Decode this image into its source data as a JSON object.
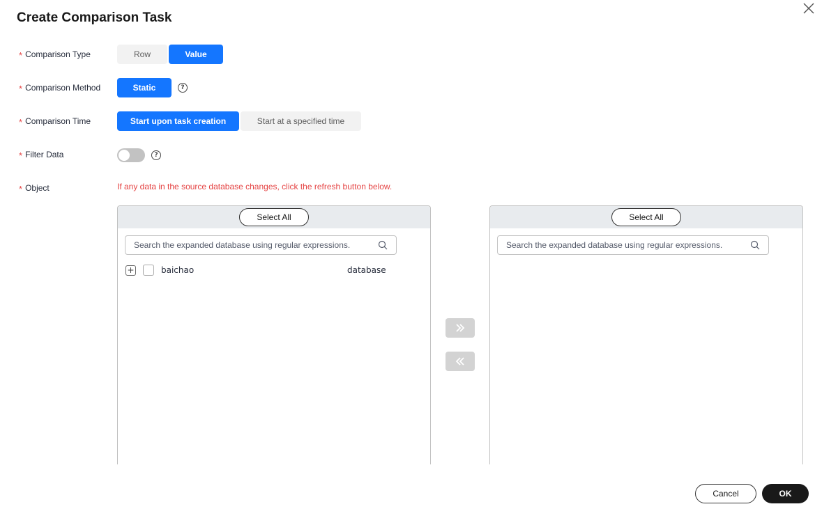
{
  "dialog": {
    "title": "Create Comparison Task",
    "close_icon": "close-icon"
  },
  "form": {
    "comparison_type": {
      "label": "Comparison Type",
      "options": [
        "Row",
        "Value"
      ],
      "selected": "Value"
    },
    "comparison_method": {
      "label": "Comparison Method",
      "options": [
        "Static"
      ],
      "selected": "Static",
      "help": "?"
    },
    "comparison_time": {
      "label": "Comparison Time",
      "options": [
        "Start upon task creation",
        "Start at a specified time"
      ],
      "selected": "Start upon task creation"
    },
    "filter_data": {
      "label": "Filter Data",
      "enabled": false,
      "help": "?"
    },
    "object": {
      "label": "Object",
      "hint": "If any data in the source database changes, click the refresh button below."
    },
    "required_mark": "*"
  },
  "transfer": {
    "left": {
      "select_all": "Select All",
      "search_placeholder": "Search the expanded database using regular expressions.",
      "items": [
        {
          "name": "baichao",
          "type": "database",
          "expander": "+"
        }
      ]
    },
    "right": {
      "select_all": "Select All",
      "search_placeholder": "Search the expanded database using regular expressions.",
      "items": []
    },
    "move_right_icon": "double-chevron-right-icon",
    "move_left_icon": "double-chevron-left-icon"
  },
  "footer": {
    "cancel_label": "Cancel",
    "ok_label": "OK"
  },
  "colors": {
    "primary": "#1476ff",
    "required": "#e54545",
    "segment_off_bg": "#f2f2f2",
    "ok_bg": "#191919",
    "transfer_disabled": "#d3d3d3"
  }
}
